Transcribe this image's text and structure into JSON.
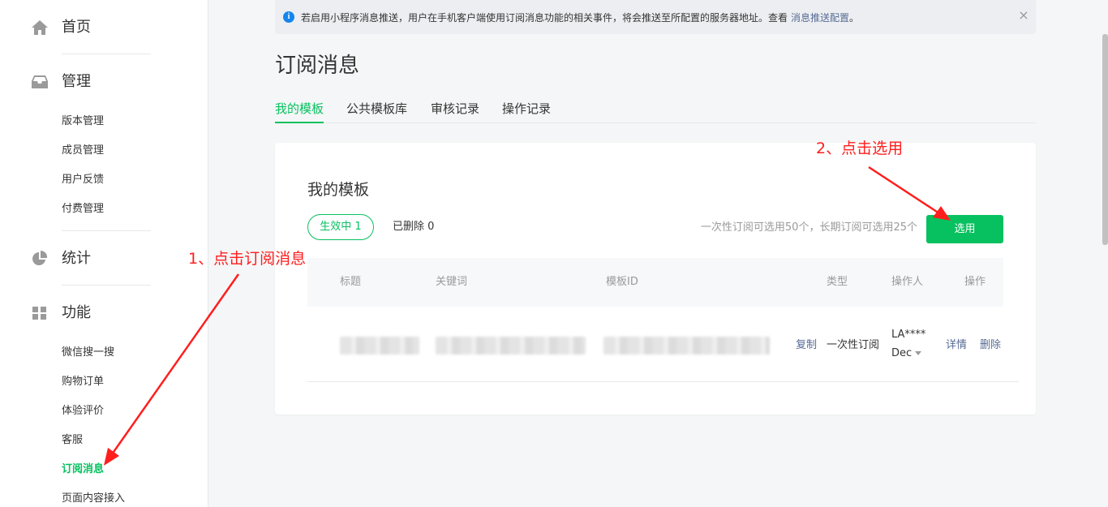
{
  "sidebar": {
    "home": {
      "label": "首页",
      "icon": "home-icon"
    },
    "manage": {
      "label": "管理",
      "icon": "inbox-icon",
      "items": [
        "版本管理",
        "成员管理",
        "用户反馈",
        "付费管理"
      ]
    },
    "stats": {
      "label": "统计",
      "icon": "pie-chart-icon"
    },
    "features": {
      "label": "功能",
      "icon": "grid-icon",
      "items": [
        "微信搜一搜",
        "购物订单",
        "体验评价",
        "客服",
        "订阅消息",
        "页面内容接入"
      ],
      "active_item": "订阅消息"
    }
  },
  "notice": {
    "text": "若启用小程序消息推送，用户在手机客户端使用订阅消息功能的相关事件，将会推送至所配置的服务器地址。查看",
    "link": "消息推送配置",
    "suffix": "。",
    "close": "×"
  },
  "page": {
    "title": "订阅消息"
  },
  "tabs": [
    "我的模板",
    "公共模板库",
    "审核记录",
    "操作记录"
  ],
  "card": {
    "title": "我的模板",
    "active_filter": "生效中  1",
    "deleted_filter": "已删除  0",
    "quota": "一次性订阅可选用50个，长期订阅可选用25个",
    "select_button": "选用",
    "table": {
      "headers": [
        "标题",
        "关键词",
        "模板ID",
        "类型",
        "操作人",
        "操作"
      ],
      "row": {
        "copy": "复制",
        "type": "一次性订阅",
        "operator": "LA****",
        "operator_sub": "Dec",
        "detail": "详情",
        "delete": "删除"
      }
    }
  },
  "annotations": {
    "step1": "1、点击订阅消息",
    "step2": "2、点击选用",
    "color": "#ff1e1e"
  },
  "colors": {
    "accent": "#07c160",
    "link": "#576b95",
    "info": "#1485ee"
  }
}
